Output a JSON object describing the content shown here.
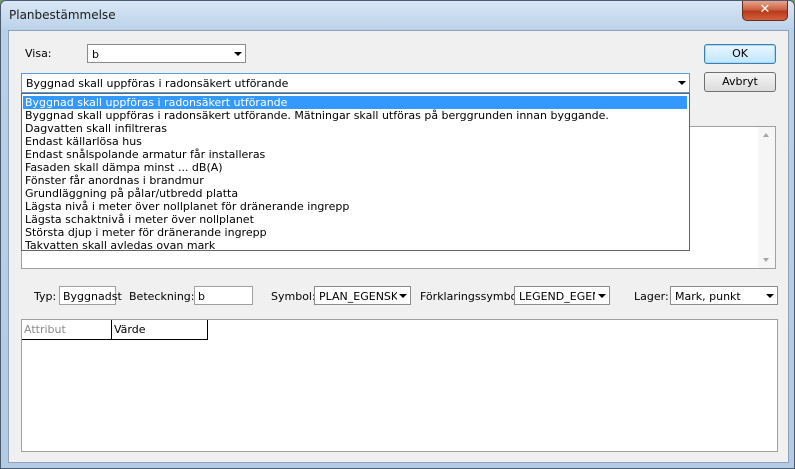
{
  "window": {
    "title": "Planbestämmelse",
    "close_label": "✕"
  },
  "visa": {
    "label": "Visa:",
    "value": "b"
  },
  "buttons": {
    "ok": "OK",
    "cancel": "Avbryt"
  },
  "main_combo": {
    "value": "Byggnad skall uppföras i radonsäkert utförande"
  },
  "dropdown_items": [
    "Byggnad skall uppföras i radonsäkert utförande",
    "Byggnad skall uppföras i radonsäkert utförande. Mätningar skall utföras på berggrunden innan byggande.",
    "Dagvatten skall infiltreras",
    "Endast källarlösa hus",
    "Endast snålspolande armatur får installeras",
    "Fasaden skall dämpa minst ... dB(A)",
    "Fönster får anordnas i brandmur",
    "Grundläggning på pålar/utbredd platta",
    "Lägsta nivå i meter över nollplanet för dränerande ingrepp",
    "Lägsta schaktnivå i meter över nollplanet",
    "Största djup i meter för dränerande ingrepp",
    "Takvatten skall avledas ovan mark"
  ],
  "selected_index": 0,
  "fields": {
    "typ_label": "Typ:",
    "typ_value": "Byggnadst",
    "beteckning_label": "Beteckning:",
    "beteckning_value": "b",
    "symbol_label": "Symbol:",
    "symbol_value": "PLAN_EGENSKA",
    "forklaring_label": "Förklaringssymbol:",
    "forklaring_value": "LEGEND_EGEN",
    "lager_label": "Lager:",
    "lager_value": "Mark, punkt"
  },
  "grid": {
    "col_attribut": "Attribut",
    "col_varde": "Värde"
  }
}
